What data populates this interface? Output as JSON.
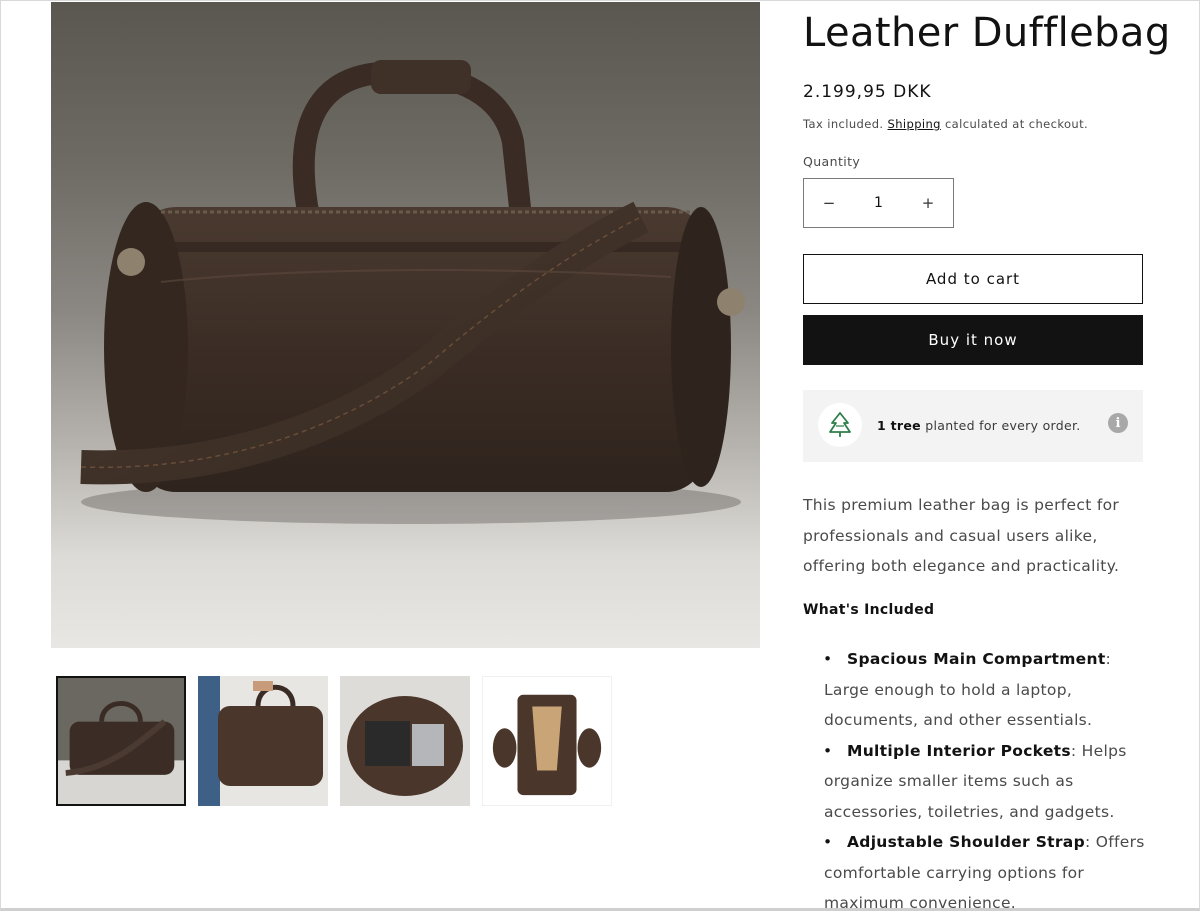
{
  "product": {
    "title": "Leather Dufflebag",
    "price": "2.199,95 DKK",
    "tax_prefix": "Tax included.",
    "shipping_link": "Shipping",
    "tax_suffix": "calculated at checkout."
  },
  "quantity": {
    "label": "Quantity",
    "value": "1",
    "minus": "−",
    "plus": "+"
  },
  "buttons": {
    "add_to_cart": "Add to cart",
    "buy_now": "Buy it now"
  },
  "tree_banner": {
    "bold": "1 tree",
    "text": "planted for every order.",
    "info": "i"
  },
  "description": "This premium leather bag is perfect for professionals and casual users alike, offering both elegance and practicality.",
  "included_heading": "What's Included",
  "features": [
    {
      "title": "Spacious Main Compartment",
      "text": ": Large enough to hold a laptop, documents, and other essentials."
    },
    {
      "title": "Multiple Interior Pockets",
      "text": ": Helps organize smaller items such as accessories, toiletries, and gadgets."
    },
    {
      "title": "Adjustable Shoulder Strap",
      "text": ": Offers comfortable carrying options for maximum convenience."
    }
  ],
  "thumbnails": [
    "bag-front-thumbnail",
    "bag-carried-thumbnail",
    "bag-open-interior-thumbnail",
    "bag-garment-open-thumbnail"
  ],
  "colors": {
    "primary": "#121212",
    "text_muted": "#4a4a4a",
    "tree_green": "#2f7d4a",
    "banner_bg": "#f3f3f3",
    "leather": "#3f3028"
  }
}
